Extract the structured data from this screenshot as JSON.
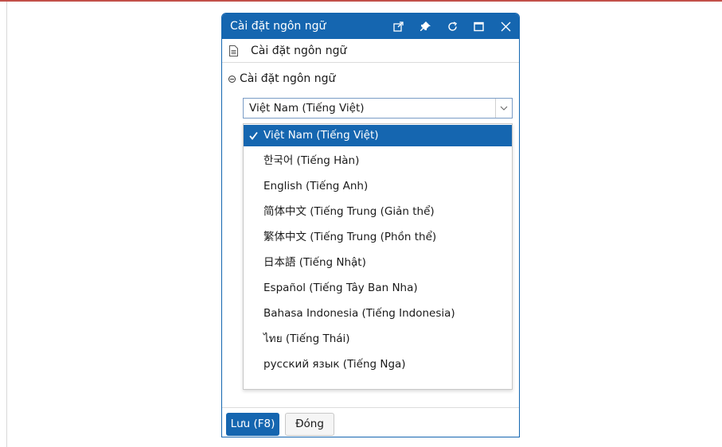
{
  "dialog": {
    "title": "Cài đặt ngôn ngữ",
    "titlebar_icons": [
      "external-link-icon",
      "pin-icon",
      "refresh-icon",
      "maximize-icon",
      "close-icon"
    ],
    "accent_color": "#1566b0"
  },
  "breadcrumb": {
    "label": "Cài đặt ngôn ngữ"
  },
  "section": {
    "title": "Cài đặt ngôn ngữ"
  },
  "language_select": {
    "value": "Việt Nam (Tiếng Việt)",
    "options": [
      "Việt Nam (Tiếng Việt)",
      "한국어 (Tiếng Hàn)",
      "English (Tiếng Anh)",
      "简体中文 (Tiếng Trung (Giản thể)",
      "繁体中文 (Tiếng Trung (Phồn thể)",
      "日本語 (Tiếng Nhật)",
      "Español (Tiếng Tây Ban Nha)",
      "Bahasa Indonesia (Tiếng Indonesia)",
      "ไทย (Tiếng Thái)",
      "русский язык (Tiếng Nga)"
    ],
    "selected_index": 0
  },
  "footer": {
    "save_label": "Lưu (F8)",
    "close_label": "Đóng"
  }
}
